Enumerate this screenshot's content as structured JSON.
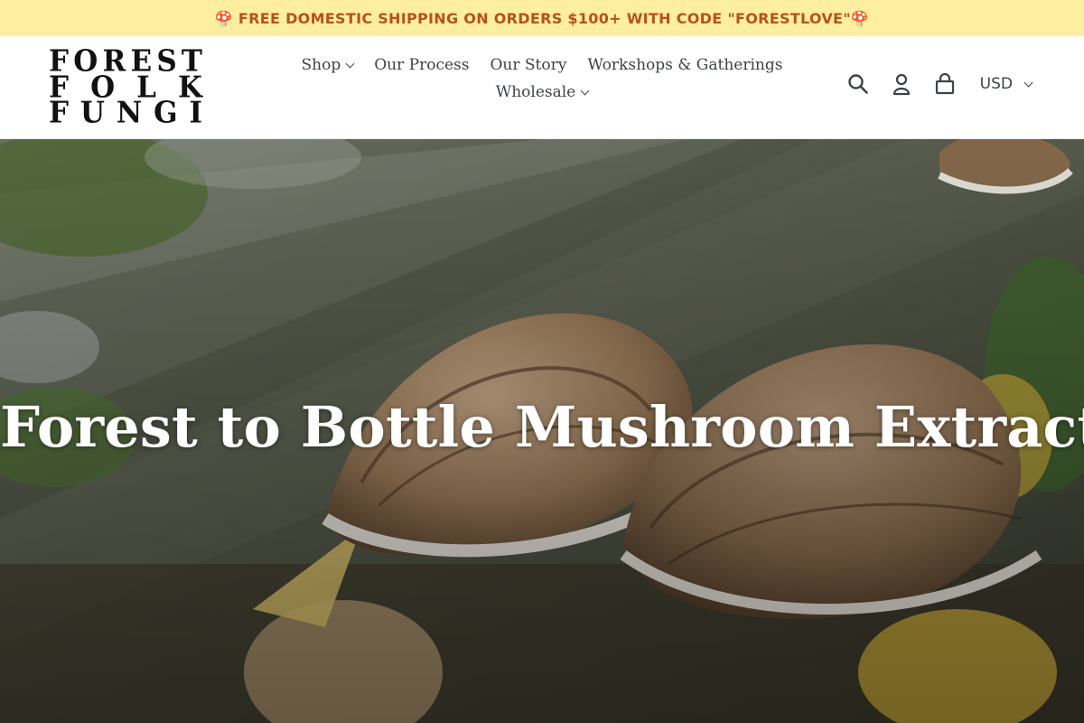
{
  "announcement": {
    "icon": "mushroom-icon",
    "text": "🍄 FREE DOMESTIC SHIPPING ON ORDERS $100+ WITH CODE \"FORESTLOVE\"🍄",
    "background": "#fdef9f",
    "color": "#b8501e"
  },
  "logo": {
    "line1": "FOREST",
    "line2": "FOLK",
    "line3": "FUNGI"
  },
  "nav": {
    "shop": "Shop",
    "process": "Our Process",
    "story": "Our Story",
    "workshops": "Workshops & Gatherings",
    "wholesale": "Wholesale"
  },
  "header": {
    "currency": "USD",
    "icons": [
      "search-icon",
      "account-icon",
      "cart-icon"
    ]
  },
  "hero": {
    "title": "Forest to Bottle Mushroom Extracts"
  }
}
